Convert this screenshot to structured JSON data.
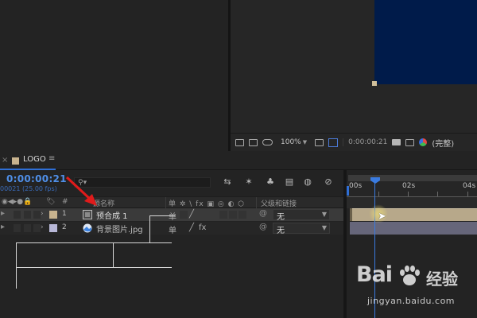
{
  "viewer": {
    "zoom": "100%",
    "timecode": "0:00:00:21",
    "quality": "(完整)"
  },
  "timeline": {
    "close_glyph": "×",
    "comp_tab": "LOGO",
    "menu_glyph": "≡",
    "current_time": "0:00:00:21",
    "frame_info": "00021 (25.00 fps)",
    "search_glyph": "⚲▾",
    "columns": {
      "source_name": "源名称",
      "switches": "单 ✲ \\ fx ▣ ◎ ◐ ⬡",
      "parent": "父级和链接"
    },
    "layers": [
      {
        "num": "1",
        "name": "预合成 1",
        "parent": "无",
        "label_color": "#c8b38e"
      },
      {
        "num": "2",
        "name": "背景图片.jpg",
        "parent": "无",
        "label_color": "#b8b8d8"
      }
    ],
    "ruler": [
      "00s",
      "02s",
      "04s"
    ]
  },
  "watermark": {
    "brand": "Bai",
    "brand_suffix": "经验",
    "url": "jingyan.baidu.com"
  },
  "colors": {
    "accent_blue": "#3a7be0",
    "comp_bg": "#001b4a",
    "layer1_bar": "#b7a88a",
    "layer2_bar": "#66667a",
    "annotation_arrow": "#e01b1b"
  }
}
